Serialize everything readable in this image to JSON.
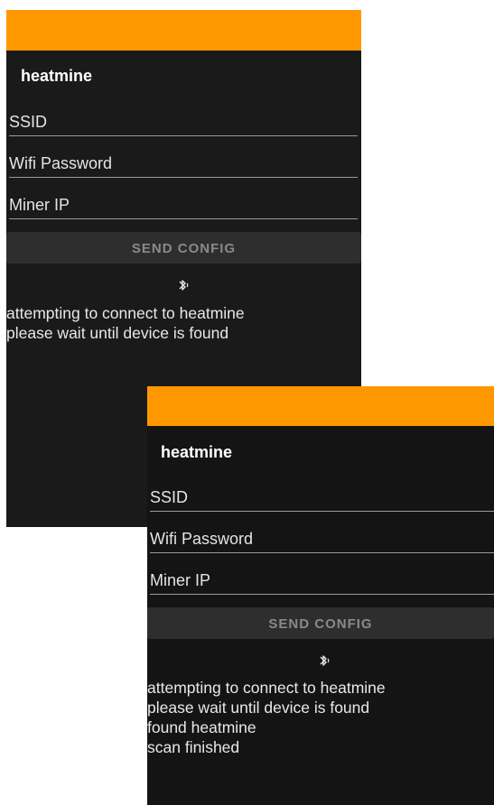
{
  "colors": {
    "status_bar": "#ff9800",
    "background": "#1a1a1a",
    "button_bg": "#2e2e2e",
    "button_text": "#8a8a8a",
    "text": "#e8e8e8"
  },
  "screens": [
    {
      "app_title": "heatmine",
      "fields": {
        "ssid_placeholder": "SSID",
        "password_placeholder": "Wifi Password",
        "miner_ip_placeholder": "Miner IP"
      },
      "send_button": "SEND CONFIG",
      "status_icon": "bluetooth-searching-icon",
      "log": [
        "attempting to connect to heatmine",
        "please wait until device is found"
      ]
    },
    {
      "app_title": "heatmine",
      "fields": {
        "ssid_placeholder": "SSID",
        "password_placeholder": "Wifi Password",
        "miner_ip_placeholder": "Miner IP"
      },
      "send_button": "SEND CONFIG",
      "status_icon": "bluetooth-searching-icon",
      "log": [
        "attempting to connect to heatmine",
        "please wait until device is found",
        "found heatmine",
        "scan finished"
      ]
    }
  ]
}
